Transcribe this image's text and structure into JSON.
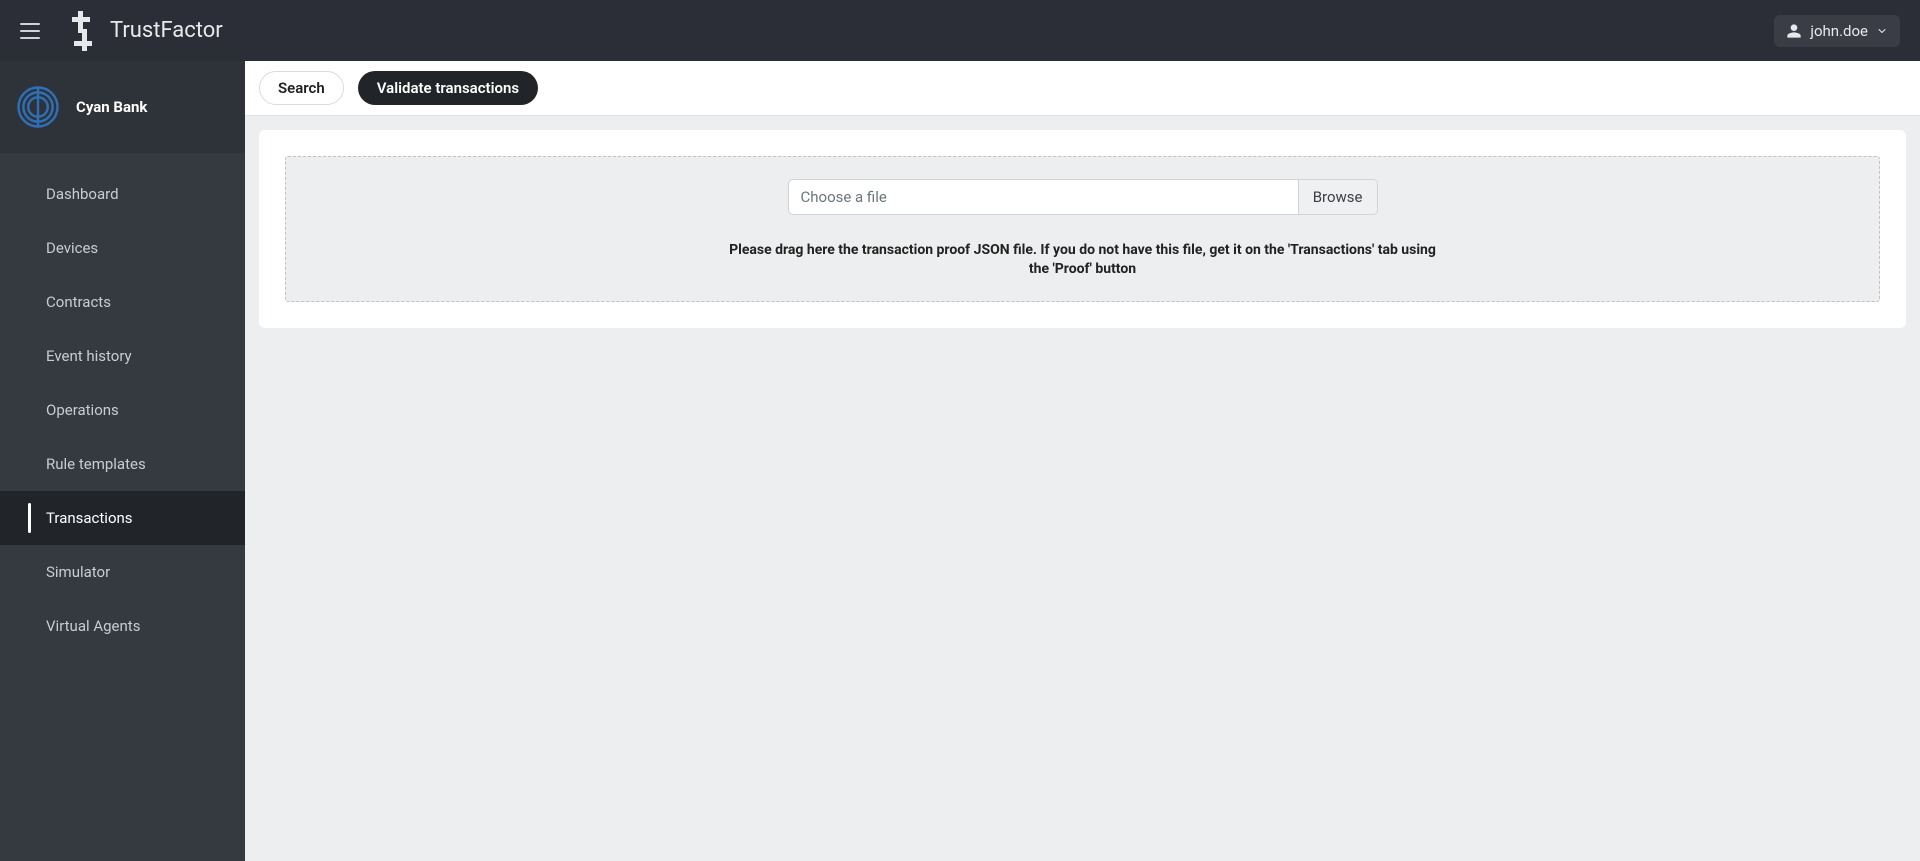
{
  "brand": "TrustFactor",
  "user": {
    "name": "john.doe"
  },
  "org": {
    "name": "Cyan Bank"
  },
  "sidebar": {
    "items": [
      {
        "label": "Dashboard",
        "active": false
      },
      {
        "label": "Devices",
        "active": false
      },
      {
        "label": "Contracts",
        "active": false
      },
      {
        "label": "Event history",
        "active": false
      },
      {
        "label": "Operations",
        "active": false
      },
      {
        "label": "Rule templates",
        "active": false
      },
      {
        "label": "Transactions",
        "active": true
      },
      {
        "label": "Simulator",
        "active": false
      },
      {
        "label": "Virtual Agents",
        "active": false
      }
    ]
  },
  "tabs": [
    {
      "label": "Search",
      "active": false
    },
    {
      "label": "Validate transactions",
      "active": true
    }
  ],
  "upload": {
    "placeholder": "Choose a file",
    "browse_label": "Browse",
    "help": "Please drag here the transaction proof JSON file. If you do not have this file, get it on the 'Transactions' tab using the 'Proof' button"
  }
}
